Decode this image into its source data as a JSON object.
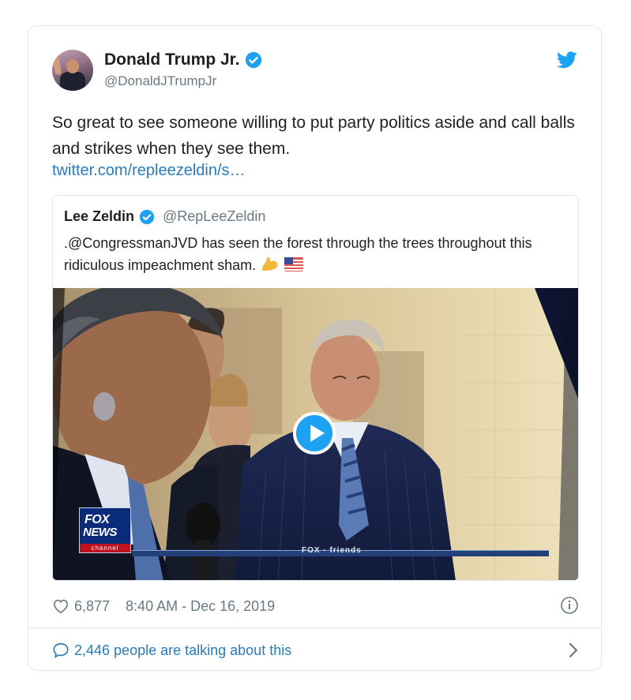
{
  "tweet": {
    "author_name": "Donald Trump Jr.",
    "author_handle": "@DonaldJTrumpJr",
    "text": "So great to see someone willing to put party politics aside and call balls and strikes when they see them.",
    "link": "twitter.com/repleezeldin/s…",
    "likes": "6,877",
    "timestamp": "8:40 AM - Dec 16, 2019",
    "talking": "2,446 people are talking about this"
  },
  "quote": {
    "author_name": "Lee Zeldin",
    "author_handle": "@RepLeeZeldin",
    "text": ".@CongressmanJVD has seen the forest through the trees throughout this ridiculous impeachment sham."
  },
  "video": {
    "logo_line1": "FOX",
    "logo_line2": "NEWS",
    "logo_line3": "channel",
    "ticker": "FOX · friends"
  },
  "icons": {
    "verified": "verified-badge-icon",
    "bird": "twitter-bird-icon",
    "play": "play-icon",
    "heart": "heart-icon",
    "info": "info-icon",
    "bubble": "comment-bubble-icon",
    "chevron": "chevron-right-icon"
  },
  "colors": {
    "link": "#2b7bb9",
    "brand": "#1da1f2",
    "muted": "#697882"
  }
}
